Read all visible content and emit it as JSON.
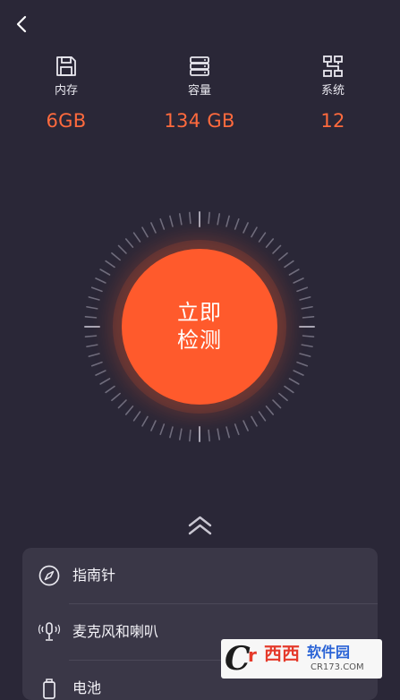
{
  "nav": {
    "back_icon": "chevron-left-icon"
  },
  "stats": [
    {
      "icon": "floppy-disk-icon",
      "label": "内存",
      "value": "6GB"
    },
    {
      "icon": "server-storage-icon",
      "label": "容量",
      "value": "134 GB"
    },
    {
      "icon": "system-tree-icon",
      "label": "系统",
      "value": "12"
    }
  ],
  "check": {
    "line1": "立即",
    "line2": "检测"
  },
  "colors": {
    "background": "#2a2737",
    "accent": "#ff5a2c",
    "value_text": "#ff6a3d",
    "panel": "#3a3747"
  },
  "expand_icon": "double-chevron-up-icon",
  "tests": [
    {
      "icon": "compass-icon",
      "label": "指南针"
    },
    {
      "icon": "microphone-icon",
      "label": "麦克风和喇叭"
    },
    {
      "icon": "battery-icon",
      "label": "电池"
    }
  ],
  "watermark": {
    "c": "C",
    "r": "r",
    "name": "西西",
    "site": "软件园",
    "domain": "CR173.COM"
  }
}
